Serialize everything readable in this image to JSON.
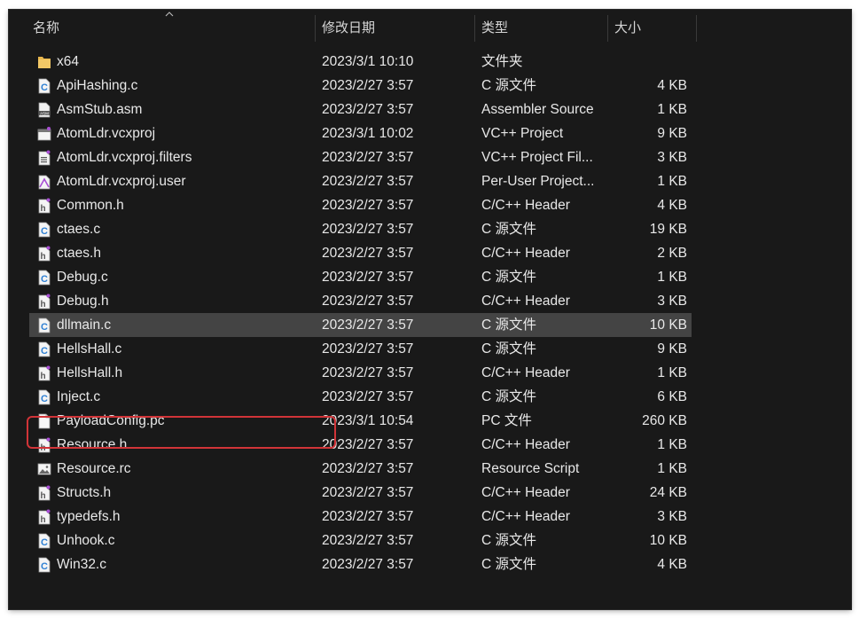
{
  "columns": {
    "name": "名称",
    "date": "修改日期",
    "type": "类型",
    "size": "大小"
  },
  "files": [
    {
      "name": "x64",
      "date": "2023/3/1 10:10",
      "type": "文件夹",
      "size": "",
      "icon": "folder-icon"
    },
    {
      "name": "ApiHashing.c",
      "date": "2023/2/27 3:57",
      "type": "C 源文件",
      "size": "4 KB",
      "icon": "c-file-icon"
    },
    {
      "name": "AsmStub.asm",
      "date": "2023/2/27 3:57",
      "type": "Assembler Source",
      "size": "1 KB",
      "icon": "asm-file-icon"
    },
    {
      "name": "AtomLdr.vcxproj",
      "date": "2023/3/1 10:02",
      "type": "VC++ Project",
      "size": "9 KB",
      "icon": "vcxproj-file-icon"
    },
    {
      "name": "AtomLdr.vcxproj.filters",
      "date": "2023/2/27 3:57",
      "type": "VC++ Project Fil...",
      "size": "3 KB",
      "icon": "filters-file-icon"
    },
    {
      "name": "AtomLdr.vcxproj.user",
      "date": "2023/2/27 3:57",
      "type": "Per-User Project...",
      "size": "1 KB",
      "icon": "user-file-icon"
    },
    {
      "name": "Common.h",
      "date": "2023/2/27 3:57",
      "type": "C/C++ Header",
      "size": "4 KB",
      "icon": "h-file-icon"
    },
    {
      "name": "ctaes.c",
      "date": "2023/2/27 3:57",
      "type": "C 源文件",
      "size": "19 KB",
      "icon": "c-file-icon"
    },
    {
      "name": "ctaes.h",
      "date": "2023/2/27 3:57",
      "type": "C/C++ Header",
      "size": "2 KB",
      "icon": "h-file-icon"
    },
    {
      "name": "Debug.c",
      "date": "2023/2/27 3:57",
      "type": "C 源文件",
      "size": "1 KB",
      "icon": "c-file-icon"
    },
    {
      "name": "Debug.h",
      "date": "2023/2/27 3:57",
      "type": "C/C++ Header",
      "size": "3 KB",
      "icon": "h-file-icon"
    },
    {
      "name": "dllmain.c",
      "date": "2023/2/27 3:57",
      "type": "C 源文件",
      "size": "10 KB",
      "icon": "c-file-icon",
      "selected": true
    },
    {
      "name": "HellsHall.c",
      "date": "2023/2/27 3:57",
      "type": "C 源文件",
      "size": "9 KB",
      "icon": "c-file-icon"
    },
    {
      "name": "HellsHall.h",
      "date": "2023/2/27 3:57",
      "type": "C/C++ Header",
      "size": "1 KB",
      "icon": "h-file-icon"
    },
    {
      "name": "Inject.c",
      "date": "2023/2/27 3:57",
      "type": "C 源文件",
      "size": "6 KB",
      "icon": "c-file-icon"
    },
    {
      "name": "PayloadConfig.pc",
      "date": "2023/3/1 10:54",
      "type": "PC 文件",
      "size": "260 KB",
      "icon": "blank-file-icon",
      "highlighted": true
    },
    {
      "name": "Resource.h",
      "date": "2023/2/27 3:57",
      "type": "C/C++ Header",
      "size": "1 KB",
      "icon": "h-file-icon"
    },
    {
      "name": "Resource.rc",
      "date": "2023/2/27 3:57",
      "type": "Resource Script",
      "size": "1 KB",
      "icon": "rc-file-icon"
    },
    {
      "name": "Structs.h",
      "date": "2023/2/27 3:57",
      "type": "C/C++ Header",
      "size": "24 KB",
      "icon": "h-file-icon"
    },
    {
      "name": "typedefs.h",
      "date": "2023/2/27 3:57",
      "type": "C/C++ Header",
      "size": "3 KB",
      "icon": "h-file-icon"
    },
    {
      "name": "Unhook.c",
      "date": "2023/2/27 3:57",
      "type": "C 源文件",
      "size": "10 KB",
      "icon": "c-file-icon"
    },
    {
      "name": "Win32.c",
      "date": "2023/2/27 3:57",
      "type": "C 源文件",
      "size": "4 KB",
      "icon": "c-file-icon"
    }
  ],
  "colors": {
    "background": "#191919",
    "selected_row": "#444444",
    "highlight_border": "#d13438",
    "c_icon_accent": "#2d7fd3",
    "h_icon_accent": "#a84fd4",
    "folder": "#e8b64c"
  }
}
